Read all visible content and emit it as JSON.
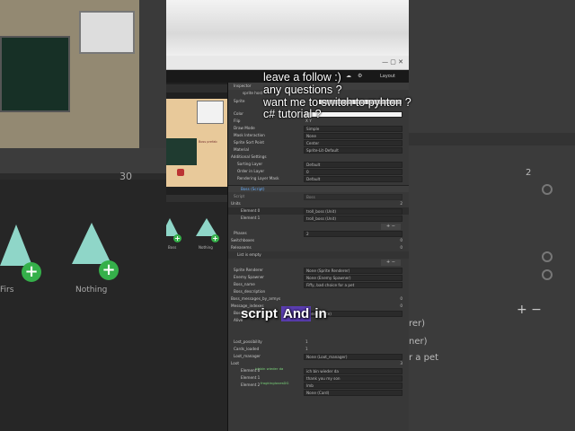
{
  "overlay": {
    "lines": [
      "leave a follow :)",
      "any questions ?",
      "want me to switch to pyhton ?",
      "c# tutorial ?"
    ],
    "subtitle_pre": "script",
    "subtitle_hl": "And",
    "subtitle_post": "in"
  },
  "window": {
    "controls": "—  ▢  ✕",
    "layout_label": "Layout"
  },
  "left_bg": {
    "asset_1": "Firs",
    "asset_2": "Nothing",
    "count": "30"
  },
  "project": {
    "asset_1": "Boss",
    "asset_2": "Nothing"
  },
  "scene": {
    "caption": "Boss prefab"
  },
  "inspector": {
    "tab": "Inspector",
    "object_name": "sprite host",
    "sprite_label": "Sprite",
    "rows": [
      {
        "label": "Color",
        "value": ""
      },
      {
        "label": "Flip",
        "value": "X  Y"
      },
      {
        "label": "Draw Mode",
        "value": "Simple"
      },
      {
        "label": "Mask Interaction",
        "value": "None"
      },
      {
        "label": "Sprite Sort Point",
        "value": "Center"
      },
      {
        "label": "Material",
        "value": "Sprite-Lit-Default"
      }
    ],
    "additional": "Additional Settings",
    "rows2": [
      {
        "label": "Sorting Layer",
        "value": "Default"
      },
      {
        "label": "Order in Layer",
        "value": "0"
      },
      {
        "label": "Rendering Layer Mask",
        "value": "Default"
      }
    ],
    "component": "Boss (Script)",
    "script_label": "Script",
    "script_value": "Boss",
    "units_label": "Units",
    "units_count": "2",
    "elements": [
      {
        "label": "Element 0",
        "value": "troll_boss (Unit)"
      },
      {
        "label": "Element 1",
        "value": "troll_boss (Unit)"
      }
    ],
    "rows3": [
      {
        "label": "Phases",
        "value": "2"
      },
      {
        "label": "Switchboxes",
        "value": "0"
      },
      {
        "label": "Releasems",
        "value": "0"
      }
    ],
    "list_empty": "List is empty",
    "rows4": [
      {
        "label": "Sprite Renderer",
        "value": "None (Sprite Renderer)"
      },
      {
        "label": "Enemy Spawner",
        "value": "None (Enemy Spawner)"
      },
      {
        "label": "Boss_name",
        "value": "Fiffy, bad choice for a pet"
      },
      {
        "label": "Boss_description",
        "value": ""
      }
    ],
    "rows5": [
      {
        "label": "Boss_messages_by_armys",
        "value": "0"
      },
      {
        "label": "Message_indexes",
        "value": "0"
      },
      {
        "label": "Boss_portrait",
        "value": "None (Sprite)"
      },
      {
        "label": "Alive",
        "value": ""
      }
    ],
    "rows6": [
      {
        "label": "Lost_possibility",
        "value": "1"
      },
      {
        "label": "Cards_loaded",
        "value": "1"
      },
      {
        "label": "Loot_manager",
        "value": "None (Loot_manager)"
      },
      {
        "label": "Loot",
        "value": "3"
      }
    ],
    "loot": [
      {
        "label": "Element 0",
        "value": "ich bin wieder da"
      },
      {
        "label": "Element 1",
        "value": "thank you my son"
      },
      {
        "label": "Element 2",
        "value": "lmb"
      }
    ],
    "loot_field": "None (Card)"
  },
  "chat": {
    "user_1": "ichbin wieder da",
    "user_2": "frogkinglovesDG"
  },
  "right_bg": {
    "labels": [
      "rer)",
      "ner)",
      "r a pet"
    ],
    "num": "2"
  }
}
